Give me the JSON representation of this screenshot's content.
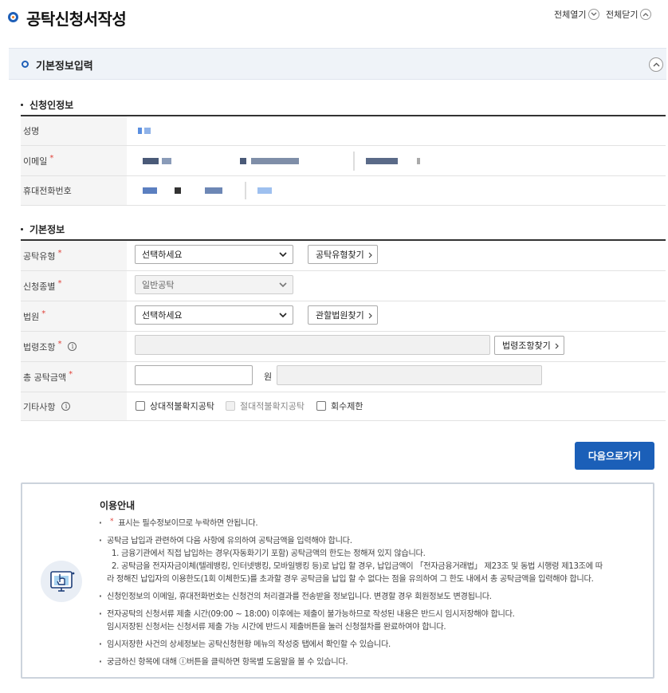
{
  "header": {
    "title": "공탁신청서작성",
    "expand_all": "전체열기",
    "collapse_all": "전체닫기"
  },
  "section": {
    "title": "기본정보입력"
  },
  "applicant": {
    "heading": "신청인정보",
    "rows": [
      {
        "label": "성명",
        "required": false
      },
      {
        "label": "이메일",
        "required": true
      },
      {
        "label": "휴대전화번호",
        "required": false
      }
    ]
  },
  "basic": {
    "heading": "기본정보",
    "deposit_type": {
      "label": "공탁유형",
      "required": true,
      "selected": "선택하세요",
      "find_label": "공탁유형찾기"
    },
    "application_type": {
      "label": "신청종별",
      "required": true,
      "selected": "일반공탁"
    },
    "court": {
      "label": "법원",
      "required": true,
      "selected": "선택하세요",
      "find_label": "관할법원찾기"
    },
    "law_article": {
      "label": "법령조항",
      "required": true,
      "find_label": "법령조항찾기"
    },
    "total_amount": {
      "label": "총 공탁금액",
      "required": true,
      "unit": "원"
    },
    "other": {
      "label": "기타사항",
      "options": [
        {
          "label": "상대적불확지공탁",
          "checked": false,
          "disabled": false
        },
        {
          "label": "절대적불확지공탁",
          "checked": false,
          "disabled": true
        },
        {
          "label": "회수제한",
          "checked": false,
          "disabled": false
        }
      ]
    }
  },
  "actions": {
    "next_label": "다음으로가기"
  },
  "guide": {
    "title": "이용안내",
    "required_note": "표시는 필수정보이므로 누락하면 안됩니다.",
    "item2_main": "공탁금 납입과 관련하여 다음 사항에 유의하여 공탁금액을 입력해야 합니다.",
    "item2_sub1": "1. 금융기관에서 직접 납입하는 경우(자동화기기 포함) 공탁금액의 한도는 정해져 있지 않습니다.",
    "item2_sub2": "2. 공탁금을 전자자금이체(텔레뱅킹, 인터넷뱅킹, 모바일뱅킹 등)로 납입 할 경우, 납입금액이 「전자금융거래법」 제23조 및 동법 시행령 제13조에 따",
    "item2_sub3": "라 정해진 납입자의 이용한도(1회 이체한도)를 초과할 경우 공탁금을 납입 할 수 없다는 점을 유의하여 그 한도 내에서 총 공탁금액을 입력해야 합니다.",
    "item3": "신청인정보의 이메일, 휴대전화번호는 신청건의 처리결과를 전송받을 정보입니다. 변경할 경우 회원정보도 변경됩니다.",
    "item4_line1": "전자공탁의 신청서류 제출 시간(09:00 ~ 18:00) 이후에는 제출이 불가능하므로 작성된 내용은 반드시 임시저장해야 합니다.",
    "item4_line2": "임시저장된 신청서는 신청서류 제출 가능 시간에 반드시 제출버튼을 눌러 신청절차를 완료하여야 합니다.",
    "item5": "임시저장한 사건의 상세정보는 공탁신청현황 메뉴의 작성중 탭에서 확인할 수 있습니다.",
    "item6": "궁금하신 항목에 대해 ⓘ버튼을 클릭하면 항목별 도움말을 볼 수 있습니다."
  },
  "colors": {
    "primary": "#1b5fb8",
    "required": "#e0433a",
    "section_bg": "#eff3f8"
  }
}
